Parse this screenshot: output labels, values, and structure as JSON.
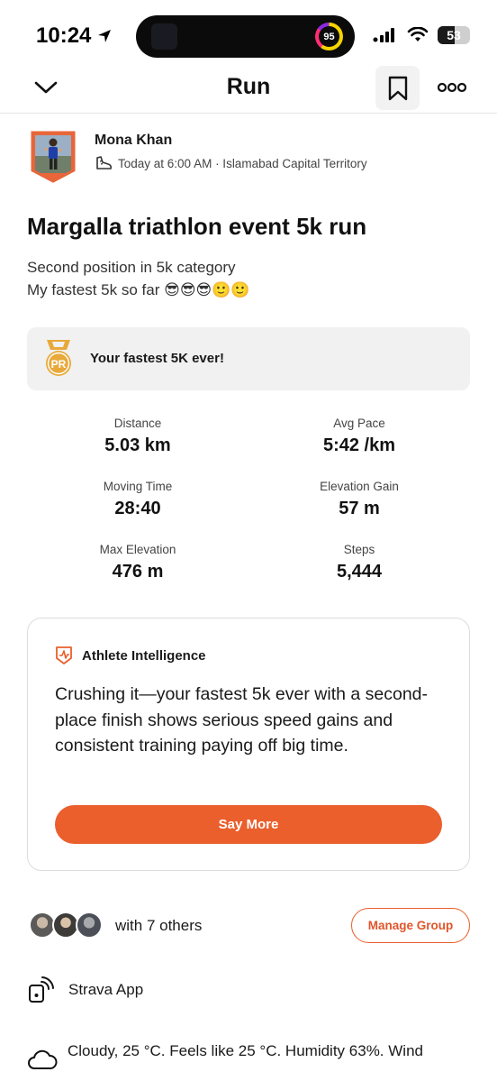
{
  "status_bar": {
    "time": "10:24",
    "activity_ring_value": "95",
    "battery": "53",
    "battery_level_percent": 53
  },
  "nav": {
    "title": "Run"
  },
  "athlete": {
    "name": "Mona Khan",
    "meta": "Today at 6:00 AM · Islamabad Capital Territory"
  },
  "activity": {
    "title": "Margalla triathlon event 5k run",
    "description_line1": "Second position in 5k category",
    "description_line2": "My fastest 5k so far 😎😎😎🙂🙂"
  },
  "pr_banner": {
    "badge_text": "PR",
    "label": "Your fastest 5K ever!"
  },
  "stats": [
    {
      "label": "Distance",
      "value": "5.03 km"
    },
    {
      "label": "Avg Pace",
      "value": "5:42 /km"
    },
    {
      "label": "Moving Time",
      "value": "28:40"
    },
    {
      "label": "Elevation Gain",
      "value": "57 m"
    },
    {
      "label": "Max Elevation",
      "value": "476 m"
    },
    {
      "label": "Steps",
      "value": "5,444"
    }
  ],
  "athlete_intelligence": {
    "title": "Athlete Intelligence",
    "body": "Crushing it—your fastest 5k ever with a second-place finish shows serious speed gains and consistent training paying off big time.",
    "button_label": "Say More"
  },
  "group": {
    "text": "with 7 others",
    "button_label": "Manage Group"
  },
  "device": {
    "label": "Strava App"
  },
  "weather": {
    "text": "Cloudy, 25 °C. Feels like 25 °C. Humidity 63%. Wind"
  },
  "colors": {
    "accent": "#ea5f2c",
    "pr_gold": "#e8a93a",
    "card_bg": "#f1f1f1"
  },
  "icons": [
    "location-arrow-icon",
    "signal-icon",
    "wifi-icon",
    "chevron-down-icon",
    "bookmark-icon",
    "more-icon",
    "shoe-icon",
    "pr-medal-icon",
    "athlete-intelligence-icon",
    "device-icon",
    "cloud-icon"
  ]
}
